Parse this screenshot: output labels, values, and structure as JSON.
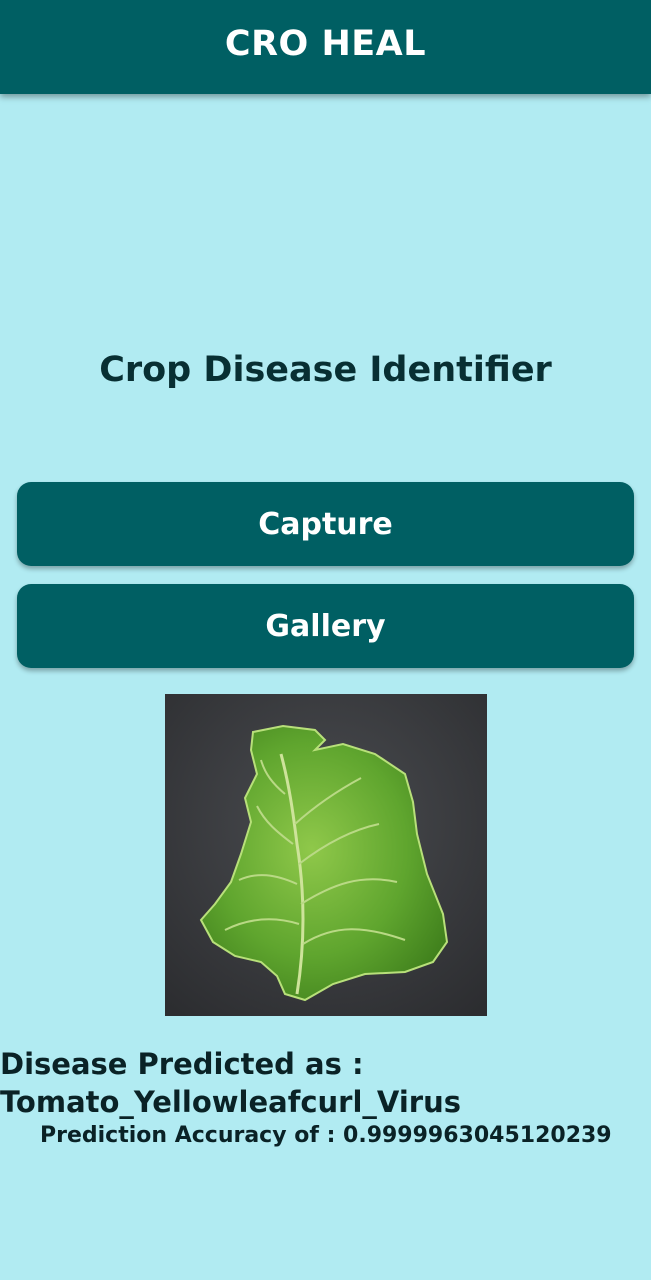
{
  "app_bar": {
    "title": "CRO HEAL"
  },
  "main": {
    "page_title": "Crop Disease Identifier",
    "capture_label": "Capture",
    "gallery_label": "Gallery",
    "image": {
      "subject": "tomato leaf",
      "background": "dark gray"
    },
    "result_label": "Disease Predicted as :",
    "result_value": "Tomato_Yellowleafcurl_Virus",
    "accuracy_text": "Prediction Accuracy of : 0.9999963045120239"
  },
  "colors": {
    "app_bar": "#005f63",
    "background": "#b1ebf2",
    "button": "#005f63",
    "text_dark": "#082f33"
  }
}
